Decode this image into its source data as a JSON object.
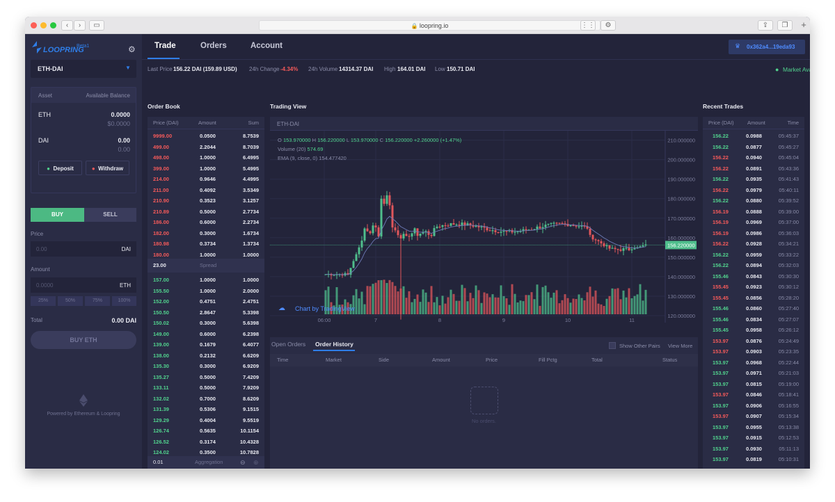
{
  "browser": {
    "url": "loopring.io"
  },
  "brand": {
    "logo": "LOOPRING",
    "beta": "Beta1"
  },
  "market_select": {
    "value": "ETH-DAI"
  },
  "balances": {
    "header_asset": "Asset",
    "header_balance": "Available Balance",
    "rows": [
      {
        "asset": "ETH",
        "amount": "0.0000",
        "usd": "$0.0000"
      },
      {
        "asset": "DAI",
        "amount": "0.00",
        "usd": "0.00"
      }
    ],
    "deposit": "Deposit",
    "withdraw": "Withdraw"
  },
  "trade_form": {
    "buy": "BUY",
    "sell": "SELL",
    "price_label": "Price",
    "price_placeholder": "0.00",
    "price_unit": "DAI",
    "amount_label": "Amount",
    "amount_placeholder": "0.0000",
    "amount_unit": "ETH",
    "pct": [
      "25%",
      "50%",
      "75%",
      "100%"
    ],
    "total_label": "Total",
    "total_value": "0.00 DAI",
    "submit": "BUY ETH"
  },
  "footer": {
    "powered": "Powered by Ethereum & Loopring"
  },
  "nav": {
    "tabs": [
      "Trade",
      "Orders",
      "Account"
    ],
    "active": "Trade",
    "wallet": "0x362a4...19eda93"
  },
  "ticker": {
    "last_price_label": "Last Price",
    "last_price": "156.22 DAI (159.89 USD)",
    "change_label": "24h Change",
    "change": "-4.34%",
    "volume_label": "24h Volume",
    "volume": "14314.37 DAI",
    "high_label": "High",
    "high": "164.01 DAI",
    "low_label": "Low",
    "low": "150.71 DAI",
    "market_status": "Market Available"
  },
  "order_book": {
    "title": "Order Book",
    "columns": [
      "Price (DAI)",
      "Amount",
      "Sum"
    ],
    "asks": [
      [
        "9999.00",
        "0.0500",
        "8.7539"
      ],
      [
        "499.00",
        "2.2044",
        "8.7039"
      ],
      [
        "498.00",
        "1.0000",
        "6.4995"
      ],
      [
        "399.00",
        "1.0000",
        "5.4995"
      ],
      [
        "214.00",
        "0.9646",
        "4.4995"
      ],
      [
        "211.00",
        "0.4092",
        "3.5349"
      ],
      [
        "210.90",
        "0.3523",
        "3.1257"
      ],
      [
        "210.89",
        "0.5000",
        "2.7734"
      ],
      [
        "186.00",
        "0.6000",
        "2.2734"
      ],
      [
        "182.00",
        "0.3000",
        "1.6734"
      ],
      [
        "180.98",
        "0.3734",
        "1.3734"
      ],
      [
        "180.00",
        "1.0000",
        "1.0000"
      ]
    ],
    "spread_value": "23.00",
    "spread_label": "Spread",
    "bids": [
      [
        "157.00",
        "1.0000",
        "1.0000"
      ],
      [
        "155.50",
        "1.0000",
        "2.0000"
      ],
      [
        "152.00",
        "0.4751",
        "2.4751"
      ],
      [
        "150.50",
        "2.8647",
        "5.3398"
      ],
      [
        "150.02",
        "0.3000",
        "5.6398"
      ],
      [
        "149.00",
        "0.6000",
        "6.2398"
      ],
      [
        "139.00",
        "0.1679",
        "6.4077"
      ],
      [
        "138.00",
        "0.2132",
        "6.6209"
      ],
      [
        "135.30",
        "0.3000",
        "6.9209"
      ],
      [
        "135.27",
        "0.5000",
        "7.4209"
      ],
      [
        "133.11",
        "0.5000",
        "7.9209"
      ],
      [
        "132.02",
        "0.7000",
        "8.6209"
      ],
      [
        "131.39",
        "0.5306",
        "9.1515"
      ],
      [
        "129.29",
        "0.4004",
        "9.5519"
      ],
      [
        "126.74",
        "0.5635",
        "10.1154"
      ],
      [
        "126.52",
        "0.3174",
        "10.4328"
      ],
      [
        "124.02",
        "0.3500",
        "10.7828"
      ],
      [
        "123.62",
        "0.4188",
        "11.2016"
      ]
    ],
    "aggregation_value": "0.01",
    "aggregation_label": "Aggregation"
  },
  "trading_view": {
    "title": "Trading View",
    "pair": "ETH-DAI",
    "ohlc": {
      "o_label": "O",
      "o": "153.970000",
      "h_label": "H",
      "h": "156.220000",
      "l_label": "L",
      "l": "153.970000",
      "c_label": "C",
      "c": "156.220000",
      "chg": "+2.260000 (+1.47%)"
    },
    "volume_label": "Volume (20)",
    "volume_value": "574.69",
    "ema_label": "EMA (9, close, 0)",
    "ema_value": "154.477420",
    "watermark": "Chart by TradingView",
    "current_price": "156.220000"
  },
  "chart_data": {
    "type": "candlestick",
    "title": "ETH-DAI",
    "x_ticks": [
      "06:00",
      "7",
      "8",
      "9",
      "10",
      "11"
    ],
    "y_ticks": [
      "210.000000",
      "200.000000",
      "190.000000",
      "180.000000",
      "170.000000",
      "160.000000",
      "150.000000",
      "140.000000",
      "130.000000",
      "120.000000"
    ],
    "ylim": [
      120,
      212
    ],
    "current_price": 156.22,
    "colors": {
      "up": "#4fbe8c",
      "down": "#e0565b"
    }
  },
  "history": {
    "tabs": [
      "Open Orders",
      "Order History"
    ],
    "active": "Order History",
    "show_other": "Show Other Pairs",
    "view_more": "View More",
    "columns": [
      "Time",
      "Market",
      "Side",
      "Amount",
      "Price",
      "Fill Pctg",
      "Total",
      "Status"
    ],
    "empty": "No orders."
  },
  "recent_trades": {
    "title": "Recent Trades",
    "columns": [
      "Price (DAI)",
      "Amount",
      "Time"
    ],
    "rows": [
      [
        "156.22",
        "0.0988",
        "05:45:37",
        "up"
      ],
      [
        "156.22",
        "0.0877",
        "05:45:27",
        "up"
      ],
      [
        "156.22",
        "0.0940",
        "05:45:04",
        "down"
      ],
      [
        "156.22",
        "0.0891",
        "05:43:36",
        "down"
      ],
      [
        "156.22",
        "0.0935",
        "05:41:43",
        "up"
      ],
      [
        "156.22",
        "0.0979",
        "05:40:11",
        "down"
      ],
      [
        "156.22",
        "0.0880",
        "05:39:52",
        "up"
      ],
      [
        "156.19",
        "0.0888",
        "05:39:00",
        "down"
      ],
      [
        "156.19",
        "0.0969",
        "05:37:00",
        "down"
      ],
      [
        "156.19",
        "0.0986",
        "05:36:03",
        "down"
      ],
      [
        "156.22",
        "0.0928",
        "05:34:21",
        "down"
      ],
      [
        "156.22",
        "0.0959",
        "05:33:22",
        "up"
      ],
      [
        "156.22",
        "0.0894",
        "05:32:03",
        "up"
      ],
      [
        "155.46",
        "0.0843",
        "05:30:30",
        "up"
      ],
      [
        "155.45",
        "0.0923",
        "05:30:12",
        "down"
      ],
      [
        "155.45",
        "0.0856",
        "05:28:20",
        "down"
      ],
      [
        "155.46",
        "0.0860",
        "05:27:40",
        "up"
      ],
      [
        "155.46",
        "0.0834",
        "05:27:07",
        "up"
      ],
      [
        "155.45",
        "0.0958",
        "05:26:12",
        "up"
      ],
      [
        "153.97",
        "0.0876",
        "05:24:49",
        "down"
      ],
      [
        "153.97",
        "0.0903",
        "05:23:35",
        "down"
      ],
      [
        "153.97",
        "0.0968",
        "05:22:44",
        "up"
      ],
      [
        "153.97",
        "0.0971",
        "05:21:03",
        "up"
      ],
      [
        "153.97",
        "0.0815",
        "05:19:00",
        "up"
      ],
      [
        "153.97",
        "0.0846",
        "05:18:41",
        "down"
      ],
      [
        "153.97",
        "0.0906",
        "05:16:55",
        "up"
      ],
      [
        "153.97",
        "0.0907",
        "05:15:34",
        "down"
      ],
      [
        "153.97",
        "0.0955",
        "05:13:38",
        "up"
      ],
      [
        "153.97",
        "0.0915",
        "05:12:53",
        "up"
      ],
      [
        "153.97",
        "0.0930",
        "05:11:13",
        "up"
      ],
      [
        "153.97",
        "0.0819",
        "05:10:31",
        "up"
      ],
      [
        "153.97",
        "0.0841",
        "05:10:02",
        "up"
      ]
    ]
  }
}
